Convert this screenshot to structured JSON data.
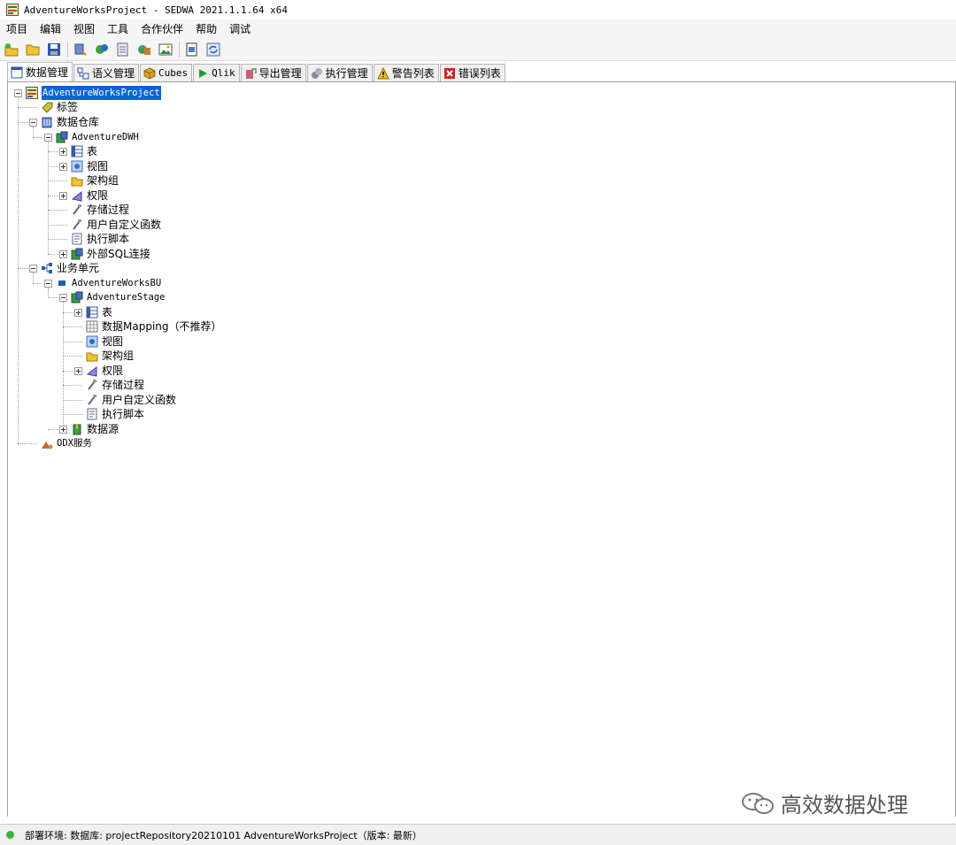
{
  "window": {
    "title": "AdventureWorksProject - SEDWA 2021.1.1.64 x64"
  },
  "menu": [
    "项目",
    "编辑",
    "视图",
    "工具",
    "合作伙伴",
    "帮助",
    "调试"
  ],
  "toolbar_icons": [
    "new-project-icon",
    "open-folder-icon",
    "save-icon",
    "deploy-icon",
    "execute-icon",
    "document-icon",
    "settings-icon",
    "image-icon",
    "export-icon",
    "refresh-icon"
  ],
  "tabs": [
    {
      "label": "数据管理",
      "icon": "database-manage-icon"
    },
    {
      "label": "语义管理",
      "icon": "semantic-icon"
    },
    {
      "label": "Cubes",
      "icon": "cube-icon"
    },
    {
      "label": "Qlik",
      "icon": "play-icon"
    },
    {
      "label": "导出管理",
      "icon": "export-manage-icon"
    },
    {
      "label": "执行管理",
      "icon": "execute-manage-icon"
    },
    {
      "label": "警告列表",
      "icon": "warning-icon"
    },
    {
      "label": "错误列表",
      "icon": "error-icon"
    }
  ],
  "tree": {
    "root": "AdventureWorksProject",
    "tags": "标签",
    "dw": "数据仓库",
    "dwh": "AdventureDWH",
    "dwh_items": [
      "表",
      "视图",
      "架构组",
      "权限",
      "存储过程",
      "用户自定义函数",
      "执行脚本",
      "外部SQL连接"
    ],
    "bu": "业务单元",
    "bu_name": "AdventureWorksBU",
    "stage": "AdventureStage",
    "stage_items": [
      "表",
      "数据Mapping（不推荐）",
      "视图",
      "架构组",
      "权限",
      "存储过程",
      "用户自定义函数",
      "执行脚本"
    ],
    "datasource": "数据源",
    "odx": "ODX服务"
  },
  "watermark": "高效数据处理",
  "status": {
    "text": "部署环境:  数据库: projectRepository20210101 AdventureWorksProject（版本: 最新）",
    "color": "#3cb43c"
  },
  "colors": {
    "selection": "#0a64d2"
  }
}
